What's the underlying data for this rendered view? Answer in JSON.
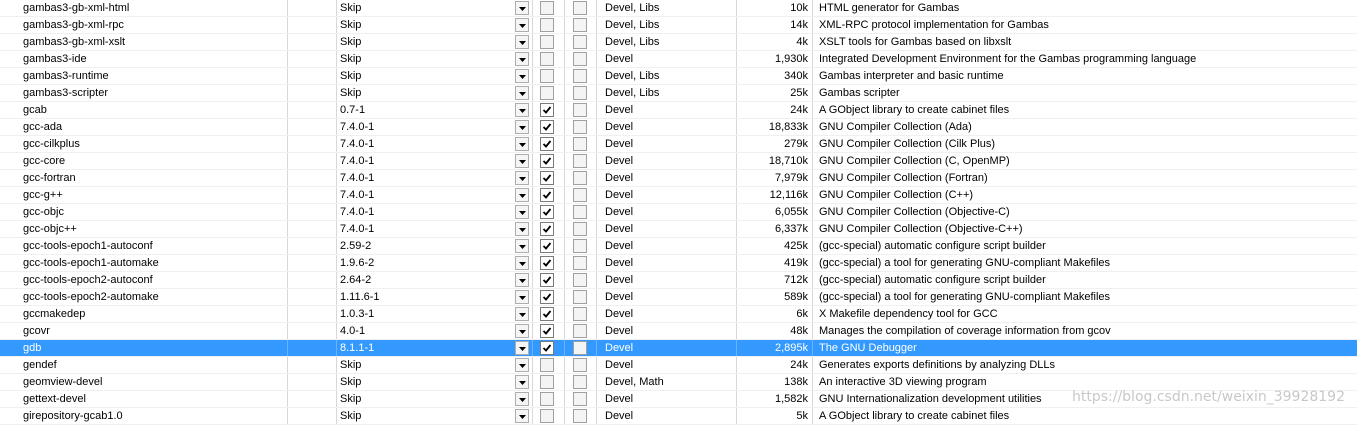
{
  "colors": {
    "selected_bg": "#3399ff",
    "selected_text": "#ffffff",
    "grid_line": "#d8d8d8"
  },
  "packages": [
    {
      "name": "gambas3-gb-xml-html",
      "version": "Skip",
      "bin": false,
      "src": false,
      "category": "Devel, Libs",
      "size": "10k",
      "description": "HTML generator for Gambas"
    },
    {
      "name": "gambas3-gb-xml-rpc",
      "version": "Skip",
      "bin": false,
      "src": false,
      "category": "Devel, Libs",
      "size": "14k",
      "description": "XML-RPC protocol implementation for Gambas"
    },
    {
      "name": "gambas3-gb-xml-xslt",
      "version": "Skip",
      "bin": false,
      "src": false,
      "category": "Devel, Libs",
      "size": "4k",
      "description": "XSLT tools for Gambas based on libxslt"
    },
    {
      "name": "gambas3-ide",
      "version": "Skip",
      "bin": false,
      "src": false,
      "category": "Devel",
      "size": "1,930k",
      "description": "Integrated Development Environment for the Gambas programming language"
    },
    {
      "name": "gambas3-runtime",
      "version": "Skip",
      "bin": false,
      "src": false,
      "category": "Devel, Libs",
      "size": "340k",
      "description": "Gambas interpreter and basic runtime"
    },
    {
      "name": "gambas3-scripter",
      "version": "Skip",
      "bin": false,
      "src": false,
      "category": "Devel, Libs",
      "size": "25k",
      "description": "Gambas scripter"
    },
    {
      "name": "gcab",
      "version": "0.7-1",
      "bin": true,
      "src": false,
      "category": "Devel",
      "size": "24k",
      "description": "A GObject library to create cabinet files"
    },
    {
      "name": "gcc-ada",
      "version": "7.4.0-1",
      "bin": true,
      "src": false,
      "category": "Devel",
      "size": "18,833k",
      "description": "GNU Compiler Collection (Ada)"
    },
    {
      "name": "gcc-cilkplus",
      "version": "7.4.0-1",
      "bin": true,
      "src": false,
      "category": "Devel",
      "size": "279k",
      "description": "GNU Compiler Collection (Cilk Plus)"
    },
    {
      "name": "gcc-core",
      "version": "7.4.0-1",
      "bin": true,
      "src": false,
      "category": "Devel",
      "size": "18,710k",
      "description": "GNU Compiler Collection (C, OpenMP)"
    },
    {
      "name": "gcc-fortran",
      "version": "7.4.0-1",
      "bin": true,
      "src": false,
      "category": "Devel",
      "size": "7,979k",
      "description": "GNU Compiler Collection (Fortran)"
    },
    {
      "name": "gcc-g++",
      "version": "7.4.0-1",
      "bin": true,
      "src": false,
      "category": "Devel",
      "size": "12,116k",
      "description": "GNU Compiler Collection (C++)"
    },
    {
      "name": "gcc-objc",
      "version": "7.4.0-1",
      "bin": true,
      "src": false,
      "category": "Devel",
      "size": "6,055k",
      "description": "GNU Compiler Collection (Objective-C)"
    },
    {
      "name": "gcc-objc++",
      "version": "7.4.0-1",
      "bin": true,
      "src": false,
      "category": "Devel",
      "size": "6,337k",
      "description": "GNU Compiler Collection (Objective-C++)"
    },
    {
      "name": "gcc-tools-epoch1-autoconf",
      "version": "2.59-2",
      "bin": true,
      "src": false,
      "category": "Devel",
      "size": "425k",
      "description": "(gcc-special) automatic configure script builder"
    },
    {
      "name": "gcc-tools-epoch1-automake",
      "version": "1.9.6-2",
      "bin": true,
      "src": false,
      "category": "Devel",
      "size": "419k",
      "description": "(gcc-special) a tool for generating GNU-compliant Makefiles"
    },
    {
      "name": "gcc-tools-epoch2-autoconf",
      "version": "2.64-2",
      "bin": true,
      "src": false,
      "category": "Devel",
      "size": "712k",
      "description": "(gcc-special) automatic configure script builder"
    },
    {
      "name": "gcc-tools-epoch2-automake",
      "version": "1.11.6-1",
      "bin": true,
      "src": false,
      "category": "Devel",
      "size": "589k",
      "description": "(gcc-special) a tool for generating GNU-compliant Makefiles"
    },
    {
      "name": "gccmakedep",
      "version": "1.0.3-1",
      "bin": true,
      "src": false,
      "category": "Devel",
      "size": "6k",
      "description": "X Makefile dependency tool for GCC"
    },
    {
      "name": "gcovr",
      "version": "4.0-1",
      "bin": true,
      "src": false,
      "category": "Devel",
      "size": "48k",
      "description": "Manages the compilation of coverage information from gcov"
    },
    {
      "name": "gdb",
      "version": "8.1.1-1",
      "bin": true,
      "src": false,
      "category": "Devel",
      "size": "2,895k",
      "description": "The GNU Debugger",
      "selected": true
    },
    {
      "name": "gendef",
      "version": "Skip",
      "bin": false,
      "src": false,
      "category": "Devel",
      "size": "24k",
      "description": "Generates exports definitions by analyzing DLLs"
    },
    {
      "name": "geomview-devel",
      "version": "Skip",
      "bin": false,
      "src": false,
      "category": "Devel, Math",
      "size": "138k",
      "description": "An interactive 3D viewing program"
    },
    {
      "name": "gettext-devel",
      "version": "Skip",
      "bin": false,
      "src": false,
      "category": "Devel",
      "size": "1,582k",
      "description": "GNU Internationalization development utilities"
    },
    {
      "name": "girepository-gcab1.0",
      "version": "Skip",
      "bin": false,
      "src": false,
      "category": "Devel",
      "size": "5k",
      "description": "A GObject library to create cabinet files"
    }
  ],
  "watermark": "https://blog.csdn.net/weixin_39928192"
}
